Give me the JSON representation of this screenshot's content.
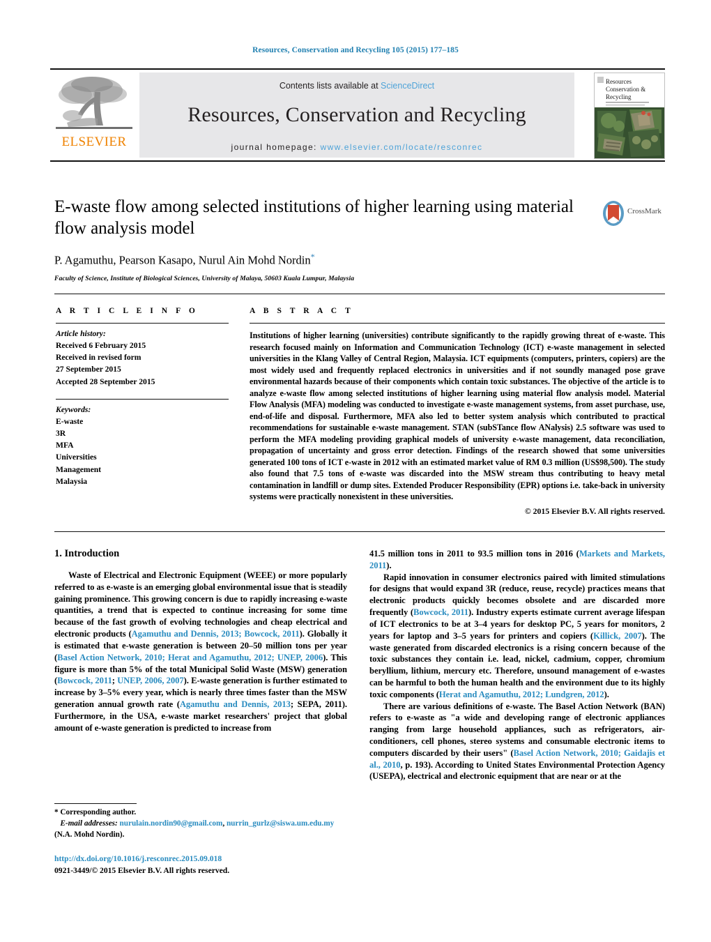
{
  "running_head": "Resources, Conservation and Recycling 105 (2015) 177–185",
  "masthead": {
    "contents_prefix": "Contents lists available at ",
    "sciencedirect": "ScienceDirect",
    "journal_name": "Resources, Conservation and Recycling",
    "homepage_prefix": "journal homepage: ",
    "homepage_url": "www.elsevier.com/locate/resconrec",
    "publisher": "ELSEVIER",
    "cover_title_line1": "Resources",
    "cover_title_line2": "Conservation &",
    "cover_title_line3": "Recycling",
    "accent_link_color": "#4ea3d8",
    "publisher_color": "#ef8200"
  },
  "article": {
    "title": "E-waste flow among selected institutions of higher learning using material flow analysis model",
    "authors": "P. Agamuthu, Pearson Kasapo, Nurul Ain Mohd Nordin",
    "corresponding_marker": "*",
    "affiliation": "Faculty of Science, Institute of Biological Sciences, University of Malaya, 50603 Kuala Lumpur, Malaysia",
    "crossmark_label": "CrossMark"
  },
  "article_info": {
    "heading": "A R T I C L E   I N F O",
    "history_label": "Article history:",
    "history": [
      "Received 6 February 2015",
      "Received in revised form",
      "27 September 2015",
      "Accepted 28 September 2015"
    ],
    "keywords_label": "Keywords:",
    "keywords": [
      "E-waste",
      "3R",
      "MFA",
      "Universities",
      "Management",
      "Malaysia"
    ]
  },
  "abstract": {
    "heading": "A B S T R A C T",
    "text": "Institutions of higher learning (universities) contribute significantly to the rapidly growing threat of e-waste. This research focused mainly on Information and Communication Technology (ICT) e-waste management in selected universities in the Klang Valley of Central Region, Malaysia. ICT equipments (computers, printers, copiers) are the most widely used and frequently replaced electronics in universities and if not soundly managed pose grave environmental hazards because of their components which contain toxic substances. The objective of the article is to analyze e-waste flow among selected institutions of higher learning using material flow analysis model. Material Flow Analysis (MFA) modeling was conducted to investigate e-waste management systems, from asset purchase, use, end-of-life and disposal. Furthermore, MFA also led to better system analysis which contributed to practical recommendations for sustainable e-waste management. STAN (subSTance flow ANalysis) 2.5 software was used to perform the MFA modeling providing graphical models of university e-waste management, data reconciliation, propagation of uncertainty and gross error detection. Findings of the research showed that some universities generated 100 tons of ICT e-waste in 2012 with an estimated market value of RM 0.3 million (US$98,500). The study also found that 7.5 tons of e-waste was discarded into the MSW stream thus contributing to heavy metal contamination in landfill or dump sites. Extended Producer Responsibility (EPR) options i.e. take-back in university systems were practically nonexistent in these universities.",
    "copyright": "© 2015 Elsevier B.V. All rights reserved."
  },
  "body": {
    "section_title": "1.  Introduction",
    "left_p1_a": "Waste of Electrical and Electronic Equipment (WEEE) or more popularly referred to as e-waste is an emerging global environmental issue that is steadily gaining prominence. This growing concern is due to rapidly increasing e-waste quantities, a trend that is expected to continue increasing for some time because of the fast growth of evolving technologies and cheap electrical and electronic products (",
    "left_cite1": "Agamuthu and Dennis, 2013; Bowcock, 2011",
    "left_p1_b": "). Globally it is estimated that e-waste generation is between 20–50 million tons per year (",
    "left_cite2": "Basel Action Network, 2010; Herat and Agamuthu, 2012; UNEP, 2006",
    "left_p1_c": "). This figure is more than 5% of the total Municipal Solid Waste (MSW) generation (",
    "left_cite3": "Bowcock, 2011",
    "left_p1_d": "; ",
    "left_cite4": "UNEP, 2006, 2007",
    "left_p1_e": "). E-waste generation is further estimated to increase by 3–5% every year, which is nearly three times faster than the MSW generation annual growth rate (",
    "left_cite5": "Agamuthu and Dennis, 2013",
    "left_p1_f": "; SEPA, 2011). Furthermore, in the USA, e-waste market researchers' project that global amount of e-waste generation is predicted to increase from",
    "right_p1_a": "41.5 million tons in 2011 to 93.5 million tons in 2016 (",
    "right_cite1": "Markets and Markets, 2011",
    "right_p1_b": ").",
    "right_p2_a": "Rapid innovation in consumer electronics paired with limited stimulations for designs that would expand 3R (reduce, reuse, recycle) practices means that electronic products quickly becomes obsolete and are discarded more frequently (",
    "right_cite2": "Bowcock, 2011",
    "right_p2_b": "). Industry experts estimate current average lifespan of ICT electronics to be at 3–4 years for desktop PC, 5 years for monitors, 2 years for laptop and 3–5 years for printers and copiers (",
    "right_cite3": "Killick, 2007",
    "right_p2_c": "). The waste generated from discarded electronics is a rising concern because of the toxic substances they contain i.e. lead, nickel, cadmium, copper, chromium beryllium, lithium, mercury etc. Therefore, unsound management of e-wastes can be harmful to both the human health and the environment due to its highly toxic components (",
    "right_cite4": "Herat and Agamuthu, 2012; Lundgren, 2012",
    "right_p2_d": ").",
    "right_p3_a": "There are various definitions of e-waste. The Basel Action Network (BAN) refers to e-waste as \"a wide and developing range of electronic appliances ranging from large household appliances, such as refrigerators, air-conditioners, cell phones, stereo systems and consumable electronic items to computers discarded by their users\" (",
    "right_cite5": "Basel Action Network, 2010; Gaidajis et al., 2010",
    "right_p3_b": ", p. 193). According to United States Environmental Protection Agency (USEPA), electrical and electronic equipment that are near or at the"
  },
  "footer": {
    "corresponding": "*  Corresponding author.",
    "email_label": "E-mail addresses:",
    "email1": "nurulain.nordin90@gmail.com",
    "email_sep": ", ",
    "email2": "nurrin_gurlz@siswa.um.edu.my",
    "email_attrib": " (N.A. Mohd Nordin).",
    "doi": "http://dx.doi.org/10.1016/j.resconrec.2015.09.018",
    "issn_line": "0921-3449/© 2015 Elsevier B.V. All rights reserved."
  }
}
